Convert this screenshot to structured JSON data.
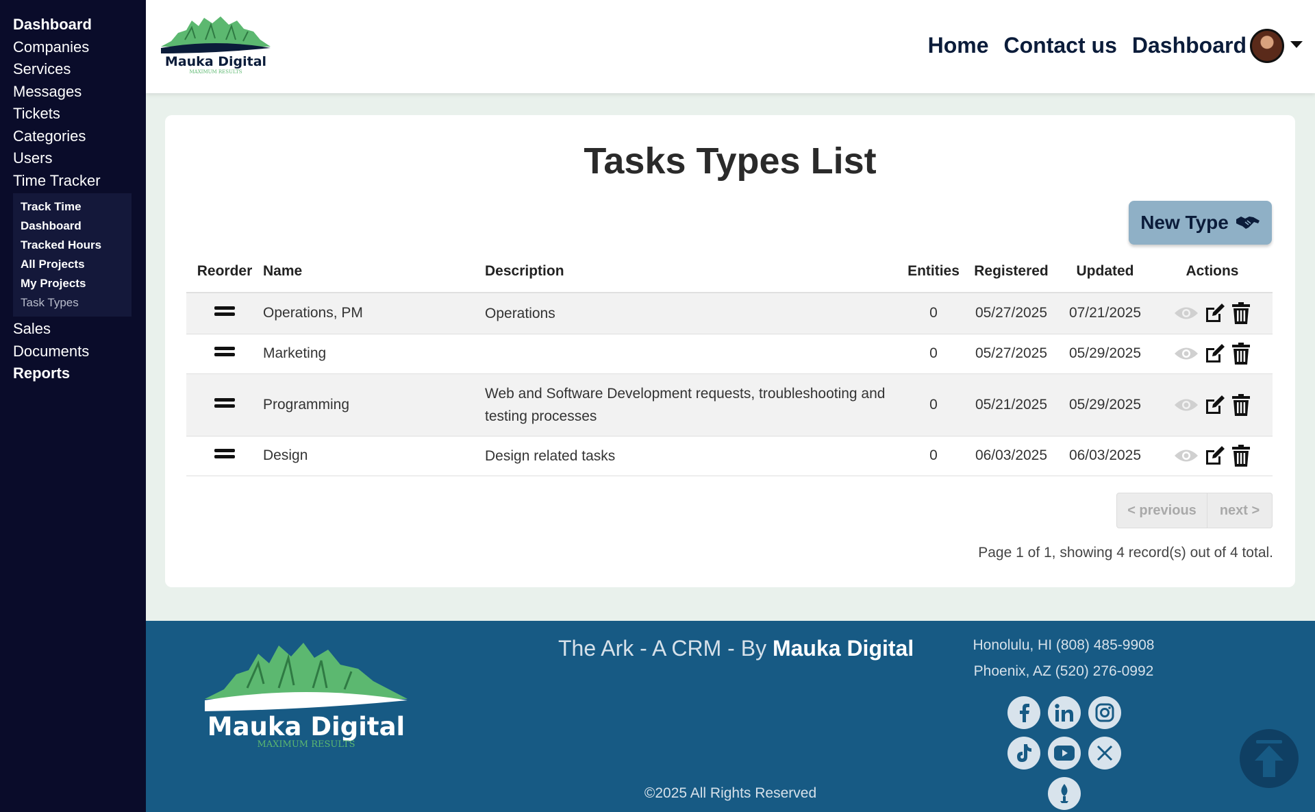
{
  "sidebar": {
    "items": [
      {
        "label": "Dashboard"
      },
      {
        "label": "Companies"
      },
      {
        "label": "Services"
      },
      {
        "label": "Messages"
      },
      {
        "label": "Tickets"
      },
      {
        "label": "Categories"
      },
      {
        "label": "Users"
      },
      {
        "label": "Time Tracker"
      }
    ],
    "submenu": [
      {
        "label": "Track Time"
      },
      {
        "label": "Dashboard"
      },
      {
        "label": "Tracked Hours"
      },
      {
        "label": "All Projects"
      },
      {
        "label": "My Projects"
      },
      {
        "label": "Task Types"
      }
    ],
    "items_after": [
      {
        "label": "Sales"
      },
      {
        "label": "Documents"
      },
      {
        "label": "Reports"
      }
    ]
  },
  "header": {
    "logo_text": "Mauka Digital",
    "logo_sub": "MAXIMUM RESULTS",
    "nav": [
      "Home",
      "Contact us",
      "Dashboard"
    ]
  },
  "main": {
    "title": "Tasks Types List",
    "new_button": "New Type",
    "columns": [
      "Reorder",
      "Name",
      "Description",
      "Entities",
      "Registered",
      "Updated",
      "Actions"
    ],
    "rows": [
      {
        "name": "Operations, PM",
        "description": "Operations",
        "entities": "0",
        "registered": "05/27/2025",
        "updated": "07/21/2025"
      },
      {
        "name": "Marketing",
        "description": "",
        "entities": "0",
        "registered": "05/27/2025",
        "updated": "05/29/2025"
      },
      {
        "name": "Programming",
        "description": "Web and Software Development requests, troubleshooting and testing processes",
        "entities": "0",
        "registered": "05/21/2025",
        "updated": "05/29/2025"
      },
      {
        "name": "Design",
        "description": "Design related tasks",
        "entities": "0",
        "registered": "06/03/2025",
        "updated": "06/03/2025"
      }
    ],
    "pager": {
      "previous": "< previous",
      "next": "next >"
    },
    "page_info": "Page 1 of 1, showing 4 record(s) out of 4 total."
  },
  "footer": {
    "tagline_prefix": "The Ark - A CRM - By ",
    "tagline_brand": "Mauka Digital",
    "address1": "Honolulu, HI (808) 485-9908",
    "address2": "Phoenix, AZ (520) 276-0992",
    "copyright": "©2025 All Rights Reserved",
    "socials": [
      "facebook-icon",
      "linkedin-icon",
      "instagram-icon",
      "tiktok-icon",
      "youtube-icon",
      "x-icon",
      "tip-icon"
    ]
  },
  "colors": {
    "sidebar_bg": "#0a0c2a",
    "footer_bg": "#175a84",
    "button_bg": "#8fb0c6",
    "logo_green": "#5cb870"
  }
}
